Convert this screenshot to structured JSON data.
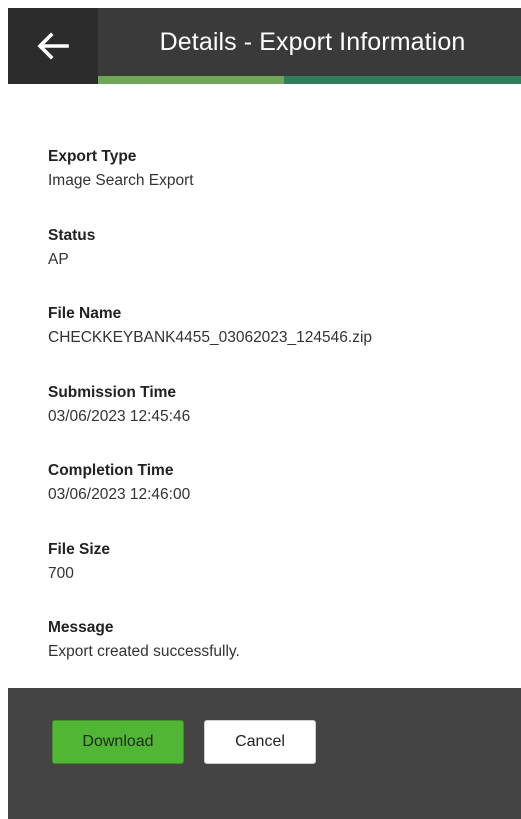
{
  "header": {
    "back_icon": "arrow-left-icon",
    "title": "Details - Export Information",
    "colors": {
      "header_bg": "#3a3a3a",
      "back_bg": "#2c2c2c",
      "accent_light": "#6fa657",
      "accent_dark": "#2f7d5e"
    }
  },
  "details": [
    {
      "label": "Export Type",
      "value": "Image Search Export"
    },
    {
      "label": "Status",
      "value": "AP"
    },
    {
      "label": "File Name",
      "value": "CHECKKEYBANK4455_03062023_124546.zip"
    },
    {
      "label": "Submission Time",
      "value": "03/06/2023 12:45:46"
    },
    {
      "label": "Completion Time",
      "value": "03/06/2023 12:46:00"
    },
    {
      "label": "File Size",
      "value": "700"
    },
    {
      "label": "Message",
      "value": "Export created successfully."
    }
  ],
  "footer": {
    "download_label": "Download",
    "cancel_label": "Cancel",
    "colors": {
      "footer_bg": "#444444",
      "download_bg": "#52b635",
      "cancel_bg": "#ffffff"
    }
  }
}
